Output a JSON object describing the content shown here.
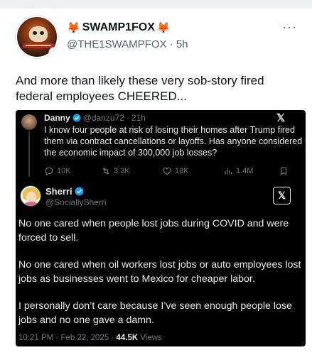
{
  "post": {
    "author_name": "SWAMP1FOX",
    "author_prefix_emoji": "🦊",
    "author_suffix_emoji": "🦊",
    "handle": "@THE1SWAMPFOX",
    "time": "5h",
    "separator": " · ",
    "more_icon": "more-horizontal-icon",
    "text": "And more than likely these very sob-story fired federal employees CHEERED..."
  },
  "screenshot": {
    "reply_parent": {
      "name": "Danny",
      "handle": "@danzu72",
      "time": "21h",
      "text": "I know four people at risk of losing their homes after Trump fired them via contract cancellations or layoffs. Has anyone considered the economic impact of 300,000 job losses?",
      "stats": {
        "replies": "10K",
        "reposts": "3.3K",
        "likes": "18K",
        "views": "1.4M"
      }
    },
    "main": {
      "name": "Sherri",
      "handle": "@SociallySherri",
      "paragraphs": [
        "No one cared when people lost jobs during COVID and were forced to sell.",
        "No one cared when oil workers lost jobs or auto employees lost jobs as businesses went to Mexico for cheaper labor.",
        "I personally don’t care because I’ve seen enough people lose jobs and no one gave a damn."
      ],
      "timestamp": "10:21 PM · Feb 22, 2025 · ",
      "views_count": "44.5K",
      "views_label": " Views"
    },
    "x_logo": "𝕏"
  },
  "colors": {
    "verified": "#1d9bf0",
    "dark_bg": "#000000",
    "muted": "#71767b"
  }
}
